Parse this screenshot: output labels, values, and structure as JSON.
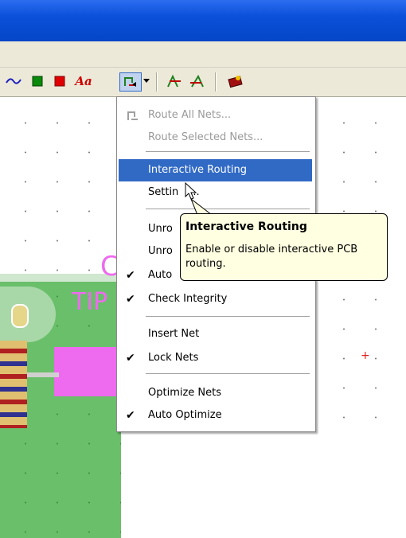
{
  "toolbar": {
    "icons": [
      "wire-icon",
      "green-square-icon",
      "red-square-icon",
      "text-icon",
      "auto-route-icon",
      "dropdown-arrow-icon",
      "flip-a-icon",
      "flip-b-icon",
      "component-icon"
    ],
    "text_icon_label": "Aa"
  },
  "menu": {
    "items": [
      {
        "label": "Route All Nets...",
        "disabled": true
      },
      {
        "label": "Route Selected Nets...",
        "disabled": true
      },
      {
        "label": "Interactive Routing",
        "highlighted": true
      },
      {
        "label": "Settings..."
      },
      {
        "label": "Unroute..."
      },
      {
        "label": "Unroute..."
      },
      {
        "label": "Auto...",
        "checked": true
      },
      {
        "label": "Check Integrity",
        "checked": true
      },
      {
        "label": "Insert Net"
      },
      {
        "label": "Lock Nets",
        "checked": true
      },
      {
        "label": "Optimize Nets"
      },
      {
        "label": "Auto Optimize",
        "checked": true
      }
    ],
    "label_settings_partial": "Settin",
    "label_settings_end": "...",
    "label_unro_1": "Unro",
    "label_unro_2": "Unro",
    "label_auto_partial": "Auto"
  },
  "tooltip": {
    "title": "Interactive Routing",
    "body": "Enable or disable interactive PCB routing."
  },
  "canvas": {
    "board_text_1": "C",
    "board_text_2": "TIP"
  },
  "colors": {
    "accent": "#316ac5",
    "tooltip_bg": "#ffffe1",
    "board": "#6abf6a",
    "pink": "#ee6aee"
  }
}
